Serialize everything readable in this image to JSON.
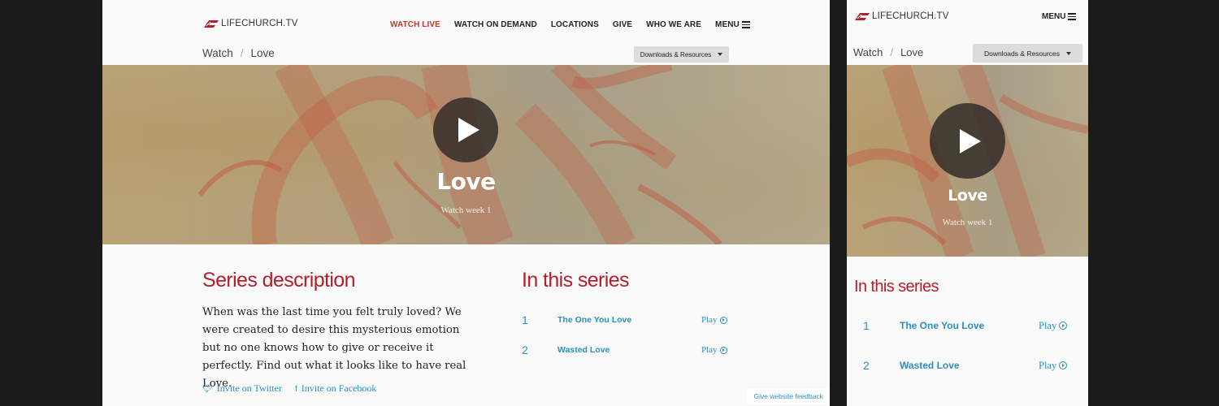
{
  "brand": {
    "logo_text": "LIFECHURCH.TV",
    "red": "#b3202a",
    "link_blue": "#2a8fc4"
  },
  "nav": {
    "items": [
      "WATCH LIVE",
      "WATCH ON DEMAND",
      "LOCATIONS",
      "GIVE",
      "WHO WE ARE"
    ],
    "menu_label": "MENU"
  },
  "breadcrumb": {
    "root": "Watch",
    "separator": "/",
    "current": "Love"
  },
  "downloads_label": "Downloads & Resources",
  "hero": {
    "title": "Love",
    "subtitle": "Watch week 1"
  },
  "description": {
    "heading": "Series description",
    "body": "When was the last time you felt truly loved? We were created to desire this mysterious emotion but no one knows how to give or receive it perfectly. Find out what it looks like to have real Love."
  },
  "invites": {
    "twitter": "Invite on Twitter",
    "facebook": "Invite on Facebook"
  },
  "series": {
    "heading": "In this series",
    "items": [
      {
        "num": "1",
        "title": "The One You Love",
        "action": "Play"
      },
      {
        "num": "2",
        "title": "Wasted Love",
        "action": "Play"
      }
    ]
  },
  "feedback_label": "Give website feedback"
}
